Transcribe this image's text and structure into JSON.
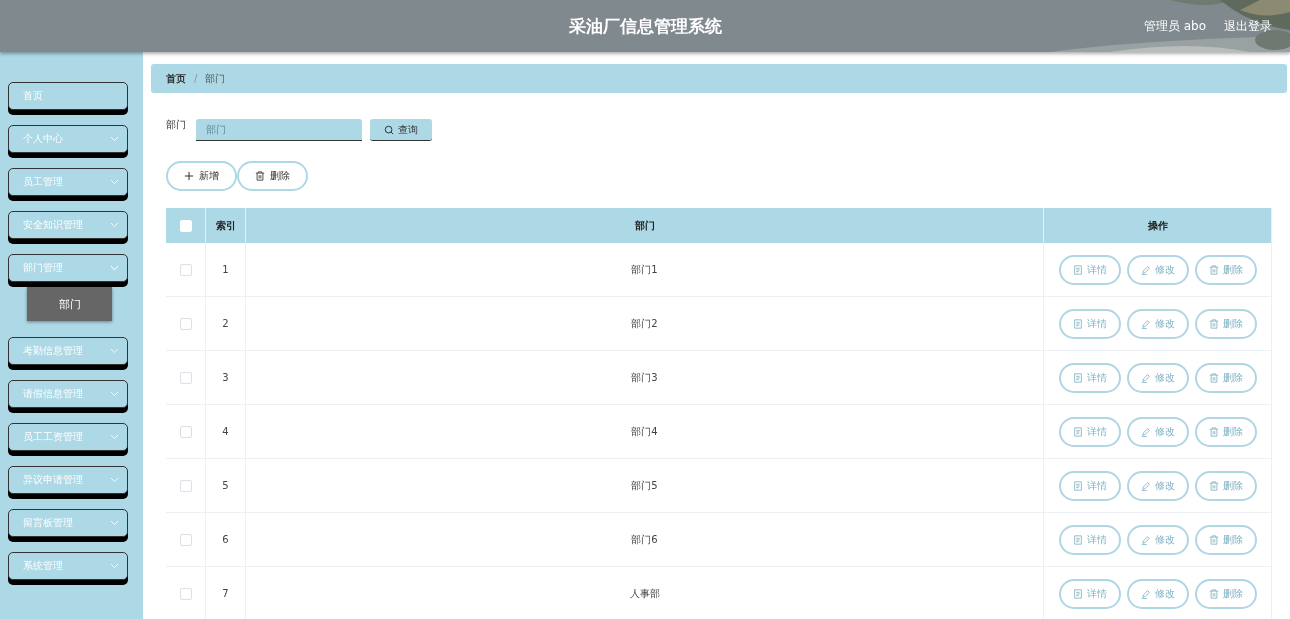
{
  "header": {
    "title": "采油厂信息管理系统",
    "user": "管理员 abo",
    "logout": "退出登录"
  },
  "sidebar": {
    "items": [
      {
        "label": "首页",
        "kind": "link"
      },
      {
        "label": "个人中心",
        "kind": "submenu",
        "expanded": false
      },
      {
        "label": "员工管理",
        "kind": "submenu",
        "expanded": false
      },
      {
        "label": "安全知识管理",
        "kind": "submenu",
        "expanded": false
      },
      {
        "label": "部门管理",
        "kind": "submenu",
        "expanded": true,
        "children": [
          {
            "label": "部门",
            "selected": true
          }
        ]
      },
      {
        "label": "考勤信息管理",
        "kind": "submenu",
        "expanded": false
      },
      {
        "label": "请假信息管理",
        "kind": "submenu",
        "expanded": false
      },
      {
        "label": "员工工资管理",
        "kind": "submenu",
        "expanded": false
      },
      {
        "label": "异议申请管理",
        "kind": "submenu",
        "expanded": false
      },
      {
        "label": "留言板管理",
        "kind": "submenu",
        "expanded": false
      },
      {
        "label": "系统管理",
        "kind": "submenu",
        "expanded": false
      }
    ]
  },
  "breadcrumb": {
    "items": [
      "首页",
      "部门"
    ],
    "separator": "/"
  },
  "search": {
    "label": "部门",
    "placeholder": "部门",
    "button": "查询"
  },
  "toolbar": [
    {
      "label": "新增",
      "kind": "add"
    },
    {
      "label": "删除",
      "kind": "delete"
    }
  ],
  "table": {
    "columns": [
      "索引",
      "部门",
      "操作"
    ],
    "all_checked": false,
    "rows": [
      {
        "index": "1",
        "dept": "部门1",
        "checked": false,
        "actions": [
          {
            "label": "详情",
            "kind": "detail"
          },
          {
            "label": "修改",
            "kind": "edit"
          },
          {
            "label": "删除",
            "kind": "delete"
          }
        ]
      },
      {
        "index": "2",
        "dept": "部门2",
        "checked": false,
        "actions": [
          {
            "label": "详情",
            "kind": "detail"
          },
          {
            "label": "修改",
            "kind": "edit"
          },
          {
            "label": "删除",
            "kind": "delete"
          }
        ]
      },
      {
        "index": "3",
        "dept": "部门3",
        "checked": false,
        "actions": [
          {
            "label": "详情",
            "kind": "detail"
          },
          {
            "label": "修改",
            "kind": "edit"
          },
          {
            "label": "删除",
            "kind": "delete"
          }
        ]
      },
      {
        "index": "4",
        "dept": "部门4",
        "checked": false,
        "actions": [
          {
            "label": "详情",
            "kind": "detail"
          },
          {
            "label": "修改",
            "kind": "edit"
          },
          {
            "label": "删除",
            "kind": "delete"
          }
        ]
      },
      {
        "index": "5",
        "dept": "部门5",
        "checked": false,
        "actions": [
          {
            "label": "详情",
            "kind": "detail"
          },
          {
            "label": "修改",
            "kind": "edit"
          },
          {
            "label": "删除",
            "kind": "delete"
          }
        ]
      },
      {
        "index": "6",
        "dept": "部门6",
        "checked": false,
        "actions": [
          {
            "label": "详情",
            "kind": "detail"
          },
          {
            "label": "修改",
            "kind": "edit"
          },
          {
            "label": "删除",
            "kind": "delete"
          }
        ]
      },
      {
        "index": "7",
        "dept": "人事部",
        "checked": false,
        "actions": [
          {
            "label": "详情",
            "kind": "detail"
          },
          {
            "label": "修改",
            "kind": "edit"
          },
          {
            "label": "删除",
            "kind": "delete"
          }
        ]
      }
    ]
  }
}
